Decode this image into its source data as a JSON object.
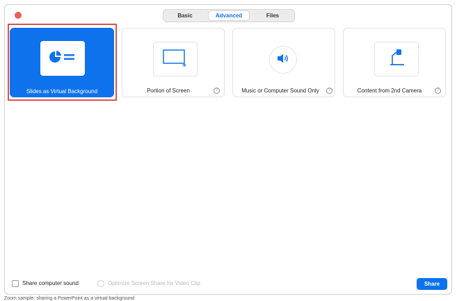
{
  "tabs": [
    {
      "label": "Basic"
    },
    {
      "label": "Advanced"
    },
    {
      "label": "Files"
    }
  ],
  "cards": [
    {
      "label": "Slides as Virtual Background",
      "icon": "pie-chart-slides-icon"
    },
    {
      "label": "Portion of Screen",
      "icon": "screen-portion-icon"
    },
    {
      "label": "Music or Computer Sound Only",
      "icon": "speaker-icon"
    },
    {
      "label": "Content from 2nd Camera",
      "icon": "document-camera-icon"
    }
  ],
  "help_glyph": "?",
  "bottom": {
    "share_sound_label": "Share computer sound",
    "optimize_label": "Optimize Screen Share for Video Clip",
    "share_button": "Share"
  },
  "caption": "Zoom sample: sharing a PowerPoint as a virtual background",
  "colors": {
    "accent": "#0e72ed",
    "close": "#ec5f56",
    "highlight": "#d9534f"
  }
}
